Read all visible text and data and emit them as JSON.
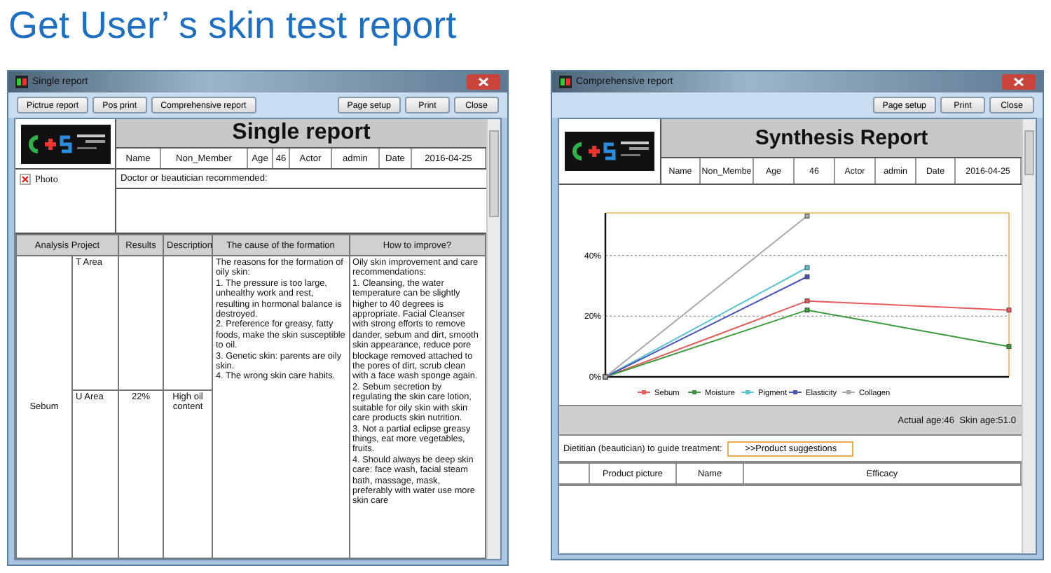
{
  "page_title": "Get User’ s skin test report",
  "single_report": {
    "window_title": "Single report",
    "toolbar_left": [
      "Pictrue report",
      "Pos print",
      "Comprehensive report"
    ],
    "toolbar_right": [
      "Page setup",
      "Print",
      "Close"
    ],
    "report_title": "Single report",
    "info": [
      "Name",
      "Non_Member",
      "Age",
      "46",
      "Actor",
      "admin",
      "Date",
      "2016-04-25"
    ],
    "photo_label": "Photo",
    "recommendation_label": "Doctor or beautician recommended:",
    "columns": [
      "Analysis Project",
      "Results",
      "Description",
      "The cause of the formation",
      "How to improve?"
    ],
    "project": "Sebum",
    "areas": [
      {
        "area": "T Area"
      },
      {
        "area": "U Area",
        "result": "22%",
        "description": "High oil content"
      }
    ],
    "cause": "The reasons for the formation of oily skin:\n1. The pressure is too large, unhealthy work and rest, resulting in hormonal balance is destroyed.\n2. Preference for greasy, fatty foods, make the skin susceptible to oil.\n3. Genetic skin: parents are oily skin.\n4. The wrong skin care habits.",
    "improve": "Oily skin improvement and care recommendations:\n1. Cleansing, the water temperature can be slightly higher to 40 degrees is appropriate. Facial Cleanser with strong efforts to remove dander, sebum and dirt, smooth skin appearance, reduce pore blockage removed attached to the pores of dirt, scrub clean with a face wash sponge again.\n2. Sebum secretion by regulating the skin care lotion, suitable for oily skin with skin care products skin nutrition.\n3. Not a partial eclipse greasy things, eat more vegetables, fruits.\n4. Should always be deep skin care: face wash, facial steam bath, massage, mask, preferably with water use more skin care"
  },
  "comprehensive_report": {
    "window_title": "Comprehensive report",
    "toolbar": [
      "Page setup",
      "Print",
      "Close"
    ],
    "report_title": "Synthesis Report",
    "info": [
      "Name",
      "Non_Membe",
      "Age",
      "46",
      "Actor",
      "admin",
      "Date",
      "2016-04-25"
    ],
    "chart_data": {
      "type": "line",
      "legend": true,
      "ylim": [
        0,
        54
      ],
      "yticks": [
        {
          "value": 0,
          "label": "0%"
        },
        {
          "value": 20,
          "label": "20%"
        },
        {
          "value": 40,
          "label": "40%"
        }
      ],
      "series": [
        {
          "name": "Sebum",
          "color": "#e85a5a",
          "marker": "square",
          "values": [
            0,
            25,
            22
          ]
        },
        {
          "name": "Moisture",
          "color": "#3c9a3c",
          "marker": "square",
          "values": [
            0,
            22,
            10
          ]
        },
        {
          "name": "Pigment",
          "color": "#5cc4d4",
          "marker": "square",
          "values": [
            0,
            36,
            null
          ]
        },
        {
          "name": "Elasticity",
          "color": "#4a56b8",
          "marker": "square",
          "values": [
            0,
            33,
            null
          ]
        },
        {
          "name": "Collagen",
          "color": "#a8a8a8",
          "marker": "square",
          "values": [
            0,
            53,
            null
          ]
        }
      ]
    },
    "ages": "Actual age:46  Skin age:51.0",
    "guide_label": "Dietitian (beautician) to guide treatment:",
    "suggestion_button": ">>Product suggestions",
    "product_columns": [
      "Product picture",
      "Name",
      "Efficacy"
    ]
  }
}
